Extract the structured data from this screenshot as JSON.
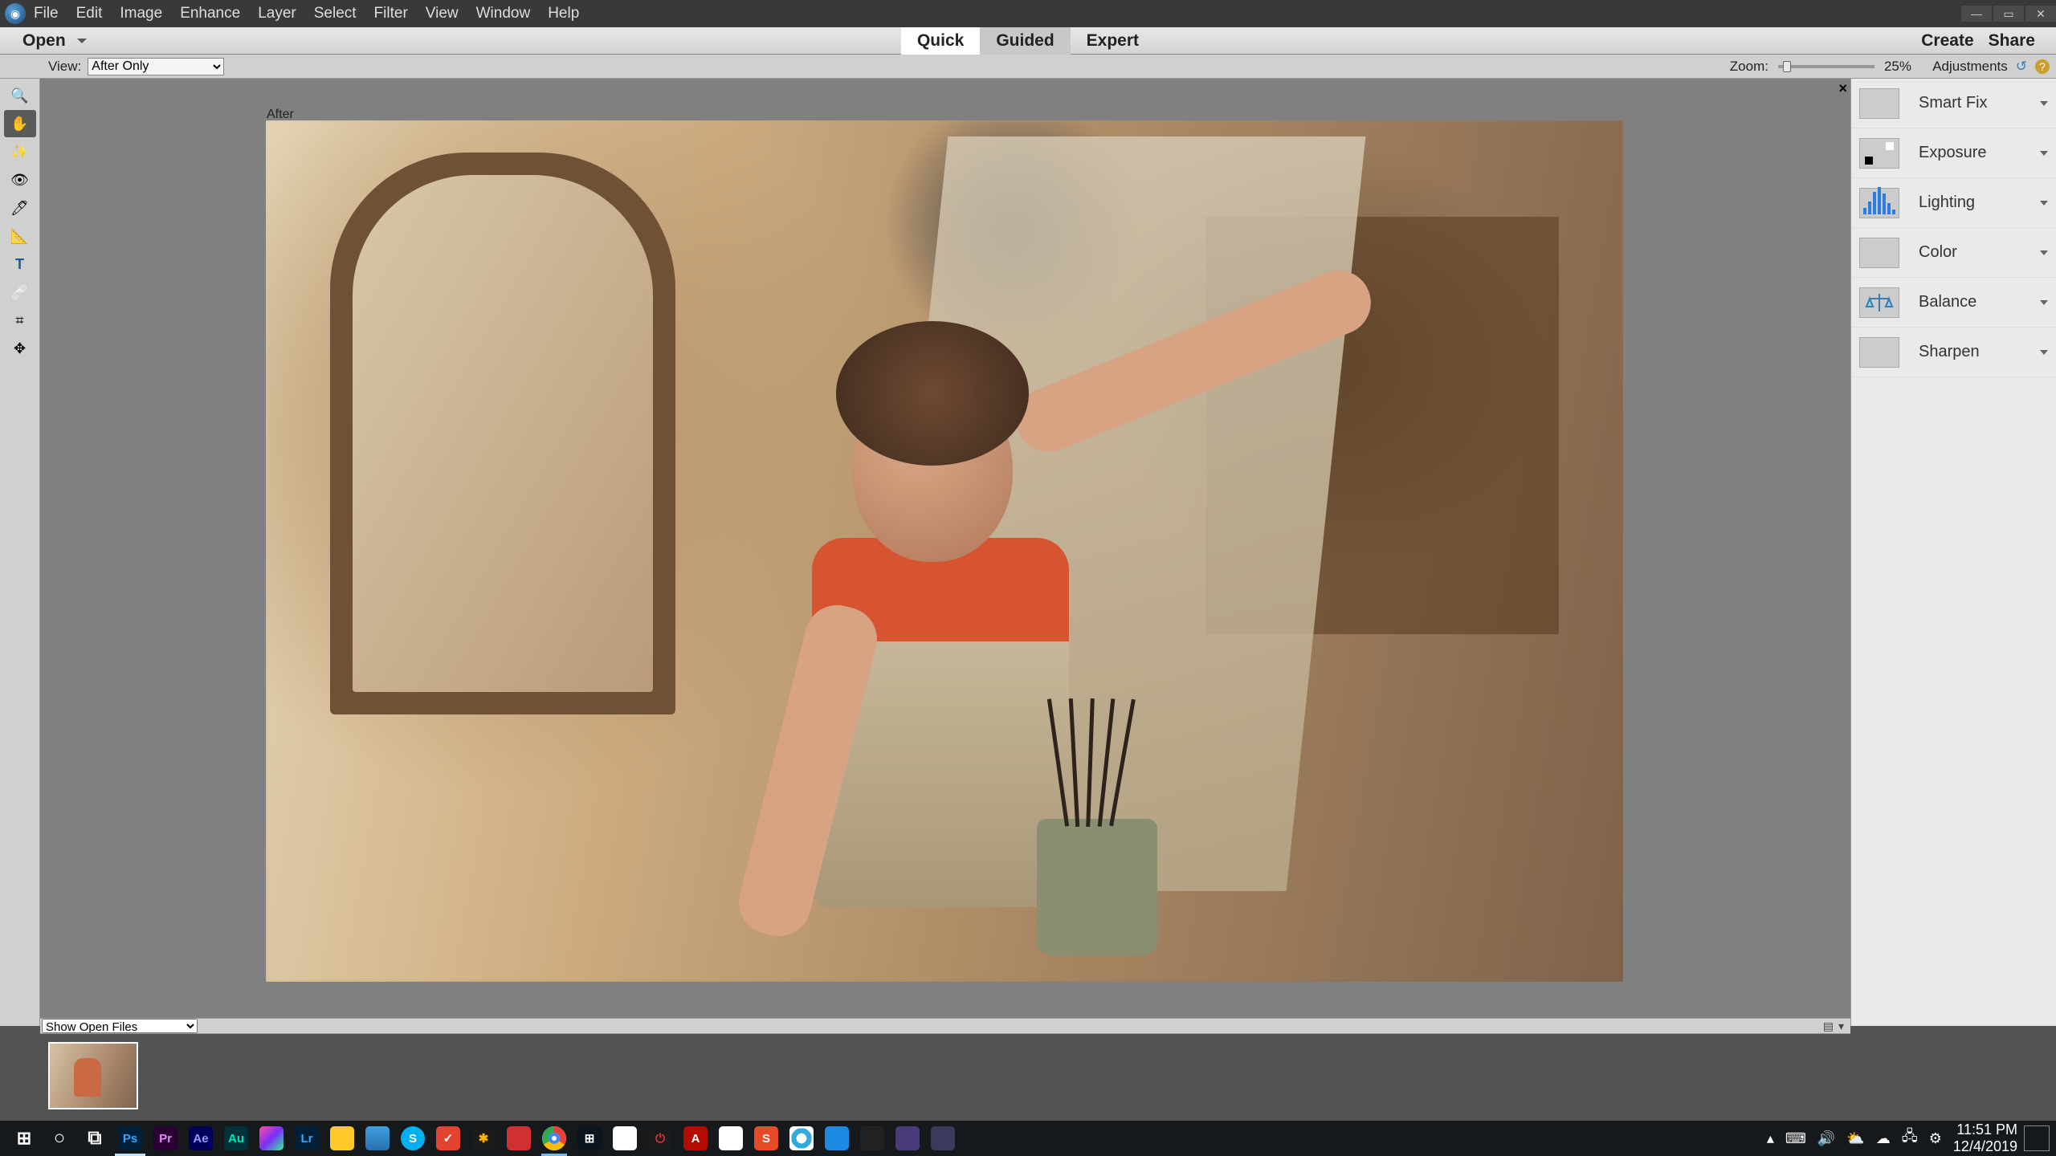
{
  "menu": {
    "items": [
      "File",
      "Edit",
      "Image",
      "Enhance",
      "Layer",
      "Select",
      "Filter",
      "View",
      "Window",
      "Help"
    ]
  },
  "actionbar": {
    "open": "Open",
    "tabs": {
      "quick": "Quick",
      "guided": "Guided",
      "expert": "Expert",
      "active": "Quick"
    },
    "create": "Create",
    "share": "Share"
  },
  "optbar": {
    "view_label": "View:",
    "view_value": "After Only",
    "zoom_label": "Zoom:",
    "zoom_value": "25%",
    "panel_label": "Adjustments"
  },
  "canvas": {
    "mode_label": "After"
  },
  "tools": [
    {
      "name": "zoom-tool",
      "active": false
    },
    {
      "name": "hand-tool",
      "active": true
    },
    {
      "name": "quick-select-tool",
      "active": false
    },
    {
      "name": "eye-tool",
      "active": false
    },
    {
      "name": "whiten-tool",
      "active": false
    },
    {
      "name": "straighten-tool",
      "active": false
    },
    {
      "name": "type-tool",
      "active": false
    },
    {
      "name": "spot-heal-tool",
      "active": false
    },
    {
      "name": "crop-tool",
      "active": false
    },
    {
      "name": "move-tool",
      "active": false
    }
  ],
  "adjustments": [
    {
      "key": "smartfix",
      "label": "Smart Fix"
    },
    {
      "key": "exposure",
      "label": "Exposure"
    },
    {
      "key": "lighting",
      "label": "Lighting"
    },
    {
      "key": "color",
      "label": "Color"
    },
    {
      "key": "balance",
      "label": "Balance"
    },
    {
      "key": "sharpen",
      "label": "Sharpen"
    }
  ],
  "photobin": {
    "dropdown": "Show Open Files"
  },
  "taskbar": {
    "items": [
      {
        "name": "start",
        "cls": "win-start",
        "glyph": "⊞"
      },
      {
        "name": "cortana",
        "cls": "",
        "glyph": "○",
        "color": "#fff"
      },
      {
        "name": "taskview",
        "cls": "",
        "glyph": "⧉",
        "color": "#fff"
      },
      {
        "name": "photoshop",
        "cls": "i-ps",
        "glyph": "Ps",
        "running": true,
        "active": true
      },
      {
        "name": "premiere",
        "cls": "i-pr",
        "glyph": "Pr"
      },
      {
        "name": "aftereffects",
        "cls": "i-ae",
        "glyph": "Ae"
      },
      {
        "name": "audition",
        "cls": "i-au",
        "glyph": "Au"
      },
      {
        "name": "prism",
        "cls": "i-prism",
        "glyph": ""
      },
      {
        "name": "lightroom",
        "cls": "i-lr",
        "glyph": "Lr"
      },
      {
        "name": "explorer",
        "cls": "i-folder",
        "glyph": ""
      },
      {
        "name": "store",
        "cls": "i-store",
        "glyph": ""
      },
      {
        "name": "skype",
        "cls": "i-skype",
        "glyph": "S"
      },
      {
        "name": "todoist",
        "cls": "i-todoist",
        "glyph": "✓"
      },
      {
        "name": "honeycomb",
        "cls": "i-honey",
        "glyph": "✱"
      },
      {
        "name": "snip",
        "cls": "i-snip",
        "glyph": ""
      },
      {
        "name": "chrome",
        "cls": "i-chrome",
        "glyph": "",
        "running": true
      },
      {
        "name": "calculator",
        "cls": "i-calc",
        "glyph": "⊞"
      },
      {
        "name": "slack",
        "cls": "i-slack",
        "glyph": ""
      },
      {
        "name": "power",
        "cls": "i-power",
        "glyph": "⏻"
      },
      {
        "name": "acrobat",
        "cls": "i-acro",
        "glyph": "A"
      },
      {
        "name": "document",
        "cls": "i-doc",
        "glyph": ""
      },
      {
        "name": "snagit",
        "cls": "i-snag",
        "glyph": "S"
      },
      {
        "name": "support",
        "cls": "i-lifesaver",
        "glyph": ""
      },
      {
        "name": "blueapp",
        "cls": "i-blue",
        "glyph": ""
      },
      {
        "name": "photos",
        "cls": "i-img",
        "glyph": ""
      },
      {
        "name": "vidapp",
        "cls": "i-vid",
        "glyph": ""
      },
      {
        "name": "pse",
        "cls": "i-pse",
        "glyph": ""
      }
    ],
    "tray": [
      "▴",
      "⌨",
      "🔊",
      "⛅",
      "☁",
      "🖧",
      "⚙"
    ],
    "time": "11:51 PM",
    "date": "12/4/2019"
  }
}
